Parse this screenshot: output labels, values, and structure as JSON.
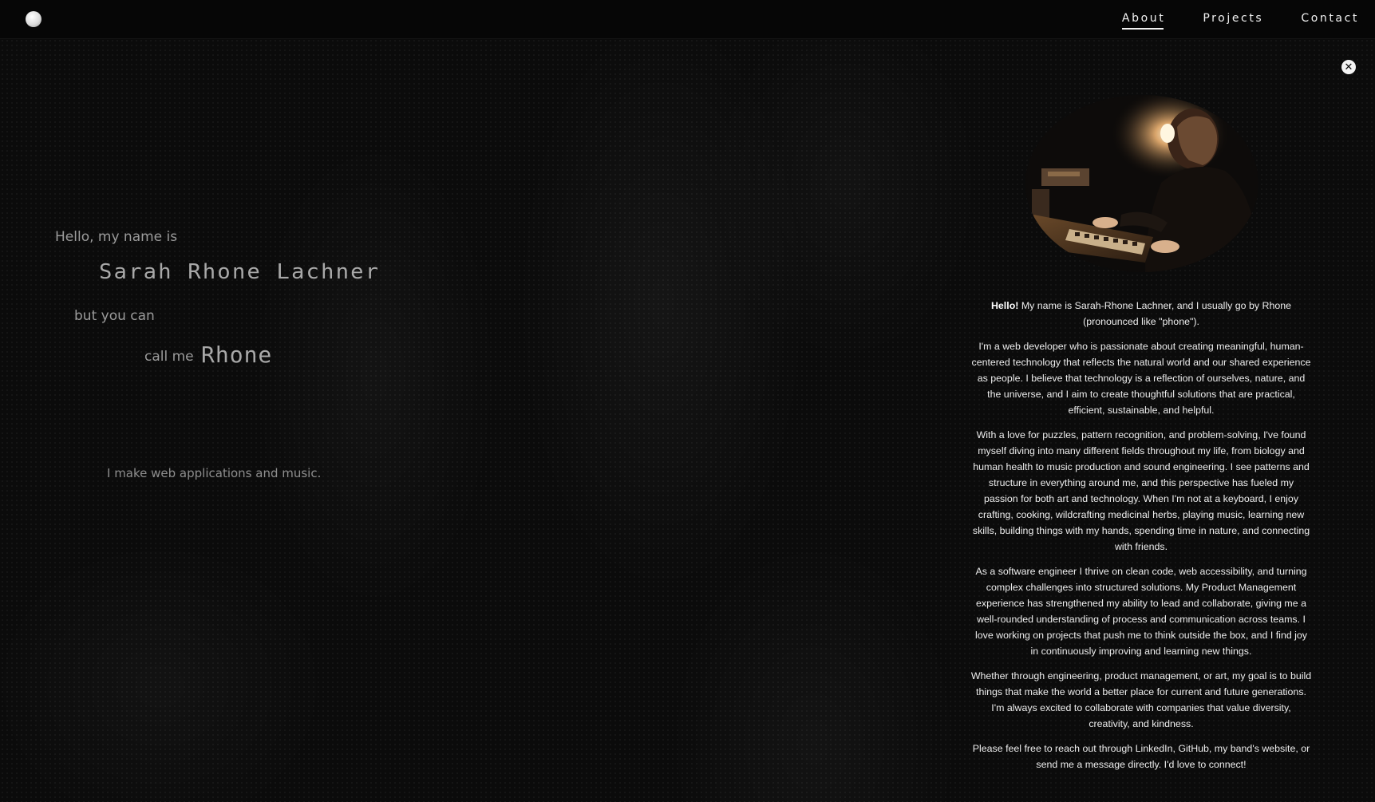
{
  "nav": {
    "logo_icon": "circle-logo-icon",
    "items": [
      {
        "label": "About",
        "active": true
      },
      {
        "label": "Projects",
        "active": false
      },
      {
        "label": "Contact",
        "active": false
      }
    ]
  },
  "hero": {
    "intro": "Hello, my name is",
    "full_name": "Sarah Rhone Lachner",
    "but_you_can": "but you can",
    "call_me": "call me",
    "nickname": "Rhone",
    "tagline": "I make web applications and music."
  },
  "about": {
    "close_icon": "close-icon",
    "photo": "portrait-at-keyboard-photo",
    "greeting_bold": "Hello!",
    "p1_rest": " My name is Sarah-Rhone Lachner, and I usually go by Rhone (pronounced like \"phone\").",
    "p2": "I'm a web developer who is passionate about creating meaningful, human-centered technology that reflects the natural world and our shared experience as people. I believe that technology is a reflection of ourselves, nature, and the universe, and I aim to create thoughtful solutions that are practical, efficient, sustainable, and helpful.",
    "p3": "With a love for puzzles, pattern recognition, and problem-solving, I've found myself diving into many different fields throughout my life, from biology and human health to music production and sound engineering. I see patterns and structure in everything around me, and this perspective has fueled my passion for both art and technology. When I'm not at a keyboard, I enjoy crafting, cooking, wildcrafting medicinal herbs, playing music, learning new skills, building things with my hands, spending time in nature, and connecting with friends.",
    "p4": "As a software engineer I thrive on clean code, web accessibility, and turning complex challenges into structured solutions. My Product Management experience has strengthened my ability to lead and collaborate, giving me a well-rounded understanding of process and communication across teams. I love working on projects that push me to think outside the box, and I find joy in continuously improving and learning new things.",
    "p5": "Whether through engineering, product management, or art, my goal is to build things that make the world a better place for current and future generations. I'm always excited to collaborate with companies that value diversity, creativity, and kindness.",
    "p6": "Please feel free to reach out through LinkedIn, GitHub, my band's website, or send me a message directly. I'd love to connect!"
  }
}
